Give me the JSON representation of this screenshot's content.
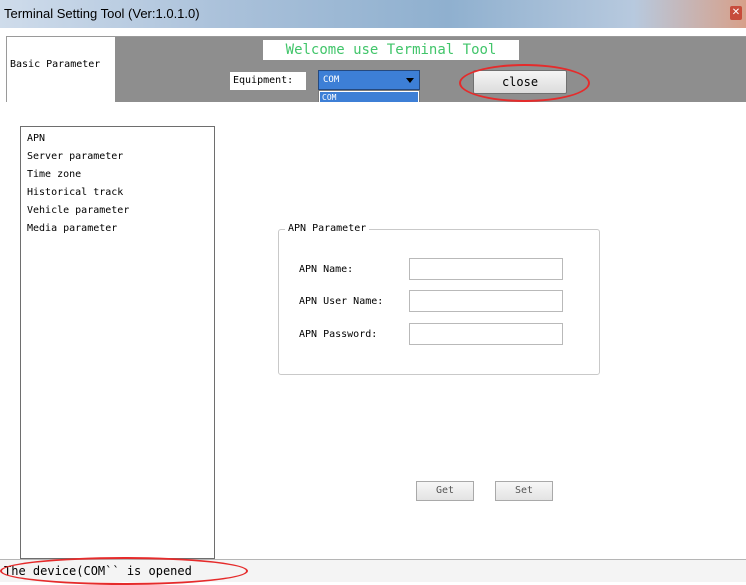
{
  "window": {
    "title": "Terminal Setting Tool (Ver:1.0.1.0)"
  },
  "header": {
    "section_label": "Basic Parameter",
    "welcome": "Welcome use Terminal Tool",
    "equipment_label": "Equipment:",
    "equipment_selected": "COM",
    "equipment_options": [
      "COM"
    ],
    "close_button": "close"
  },
  "nav": {
    "items": [
      {
        "label": "APN"
      },
      {
        "label": "Server parameter"
      },
      {
        "label": "Time zone"
      },
      {
        "label": "Historical track"
      },
      {
        "label": "Vehicle parameter"
      },
      {
        "label": "Media parameter"
      }
    ]
  },
  "apn_panel": {
    "title": "APN Parameter",
    "fields": [
      {
        "label": "APN Name:",
        "value": ""
      },
      {
        "label": "APN User Name:",
        "value": ""
      },
      {
        "label": "APN Password:",
        "value": ""
      }
    ]
  },
  "actions": {
    "get": "Get",
    "set": "Set"
  },
  "status": {
    "text": "The device(COM`` is opened"
  },
  "colors": {
    "highlight_ring": "#e52b2b",
    "welcome_text": "#41c56a",
    "selection": "#3d7fd6",
    "header_band": "#8e8e8e"
  }
}
